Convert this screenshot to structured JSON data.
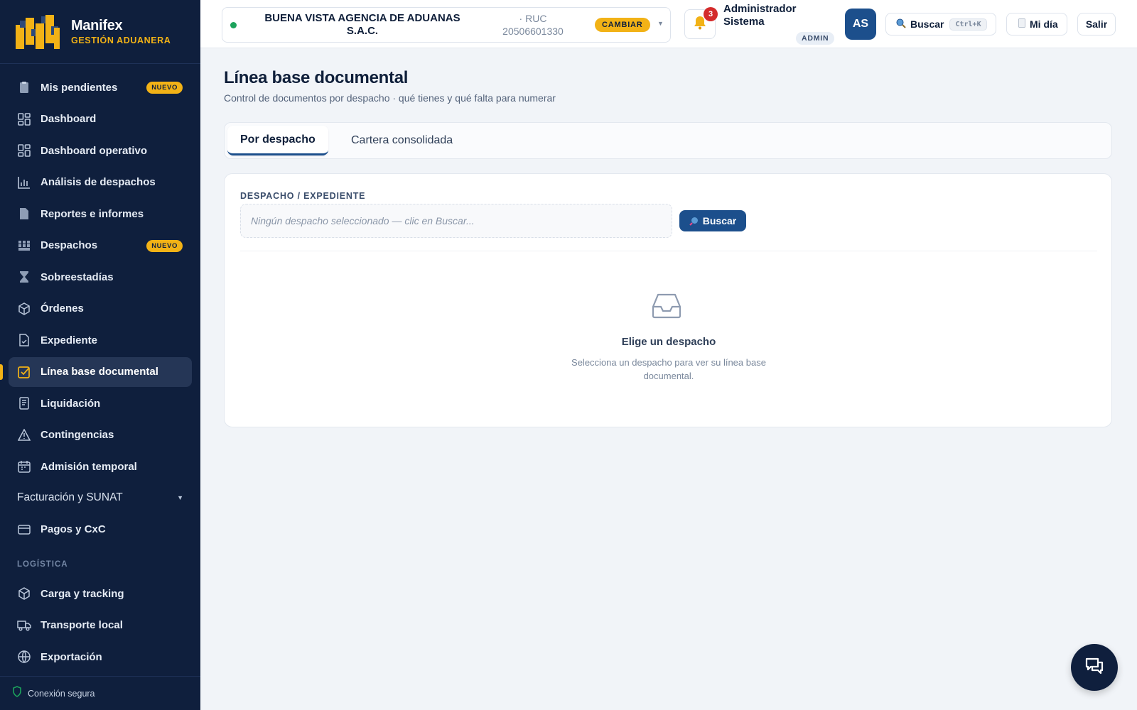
{
  "brand": {
    "name": "Manifex",
    "subtitle": "GESTIÓN ADUANERA"
  },
  "sidebar": {
    "items": [
      {
        "label": "Mis pendientes",
        "badge": "NUEVO",
        "icon": "clipboard-icon"
      },
      {
        "label": "Dashboard",
        "icon": "grid-icon"
      },
      {
        "label": "Dashboard operativo",
        "icon": "grid-icon"
      },
      {
        "label": "Análisis de despachos",
        "icon": "bar-chart-icon"
      },
      {
        "label": "Reportes e informes",
        "icon": "document-icon"
      },
      {
        "label": "Despachos",
        "badge": "NUEVO",
        "icon": "containers-icon"
      },
      {
        "label": "Sobreestadías",
        "icon": "hourglass-icon"
      },
      {
        "label": "Órdenes",
        "icon": "box-icon"
      },
      {
        "label": "Expediente",
        "icon": "file-icon"
      },
      {
        "label": "Línea base documental",
        "icon": "checklist-icon",
        "active": true
      },
      {
        "label": "Liquidación",
        "icon": "receipt-icon"
      },
      {
        "label": "Contingencias",
        "icon": "warning-icon"
      },
      {
        "label": "Admisión temporal",
        "icon": "calendar-icon"
      }
    ],
    "group": {
      "label": "Facturación y SUNAT"
    },
    "payments": {
      "label": "Pagos y CxC",
      "icon": "card-icon"
    },
    "section_logistica": "LOGÍSTICA",
    "logistica_items": [
      {
        "label": "Carga y tracking",
        "icon": "box-icon"
      },
      {
        "label": "Transporte local",
        "icon": "truck-icon"
      },
      {
        "label": "Exportación",
        "icon": "globe-icon"
      }
    ],
    "footer": "Conexión segura"
  },
  "topbar": {
    "company_name": "BUENA VISTA AGENCIA DE ADUANAS S.A.C.",
    "ruc_label": "· RUC",
    "ruc_value": "20506601330",
    "change_label": "CAMBIAR",
    "notifications_count": "3",
    "user_name": "Administrador Sistema",
    "user_role": "ADMIN",
    "avatar_initials": "AS",
    "search_label": "Buscar",
    "search_shortcut": "Ctrl+K",
    "my_day_label": "Mi día",
    "logout_label": "Salir"
  },
  "main": {
    "title": "Línea base documental",
    "subtitle": "Control de documentos por despacho · qué tienes y qué falta para numerar",
    "tabs": [
      {
        "label": "Por despacho",
        "active": true
      },
      {
        "label": "Cartera consolidada"
      }
    ],
    "field_label": "DESPACHO / EXPEDIENTE",
    "picker_placeholder": "Ningún despacho seleccionado — clic en Buscar...",
    "search_button": "Buscar",
    "empty_title": "Elige un despacho",
    "empty_text": "Selecciona un despacho para ver su línea base documental."
  },
  "colors": {
    "sidebar_bg": "#0f1f3d",
    "accent": "#f2b216",
    "primary": "#1c4f8c",
    "danger": "#d42b2b",
    "online": "#1ca35c"
  }
}
